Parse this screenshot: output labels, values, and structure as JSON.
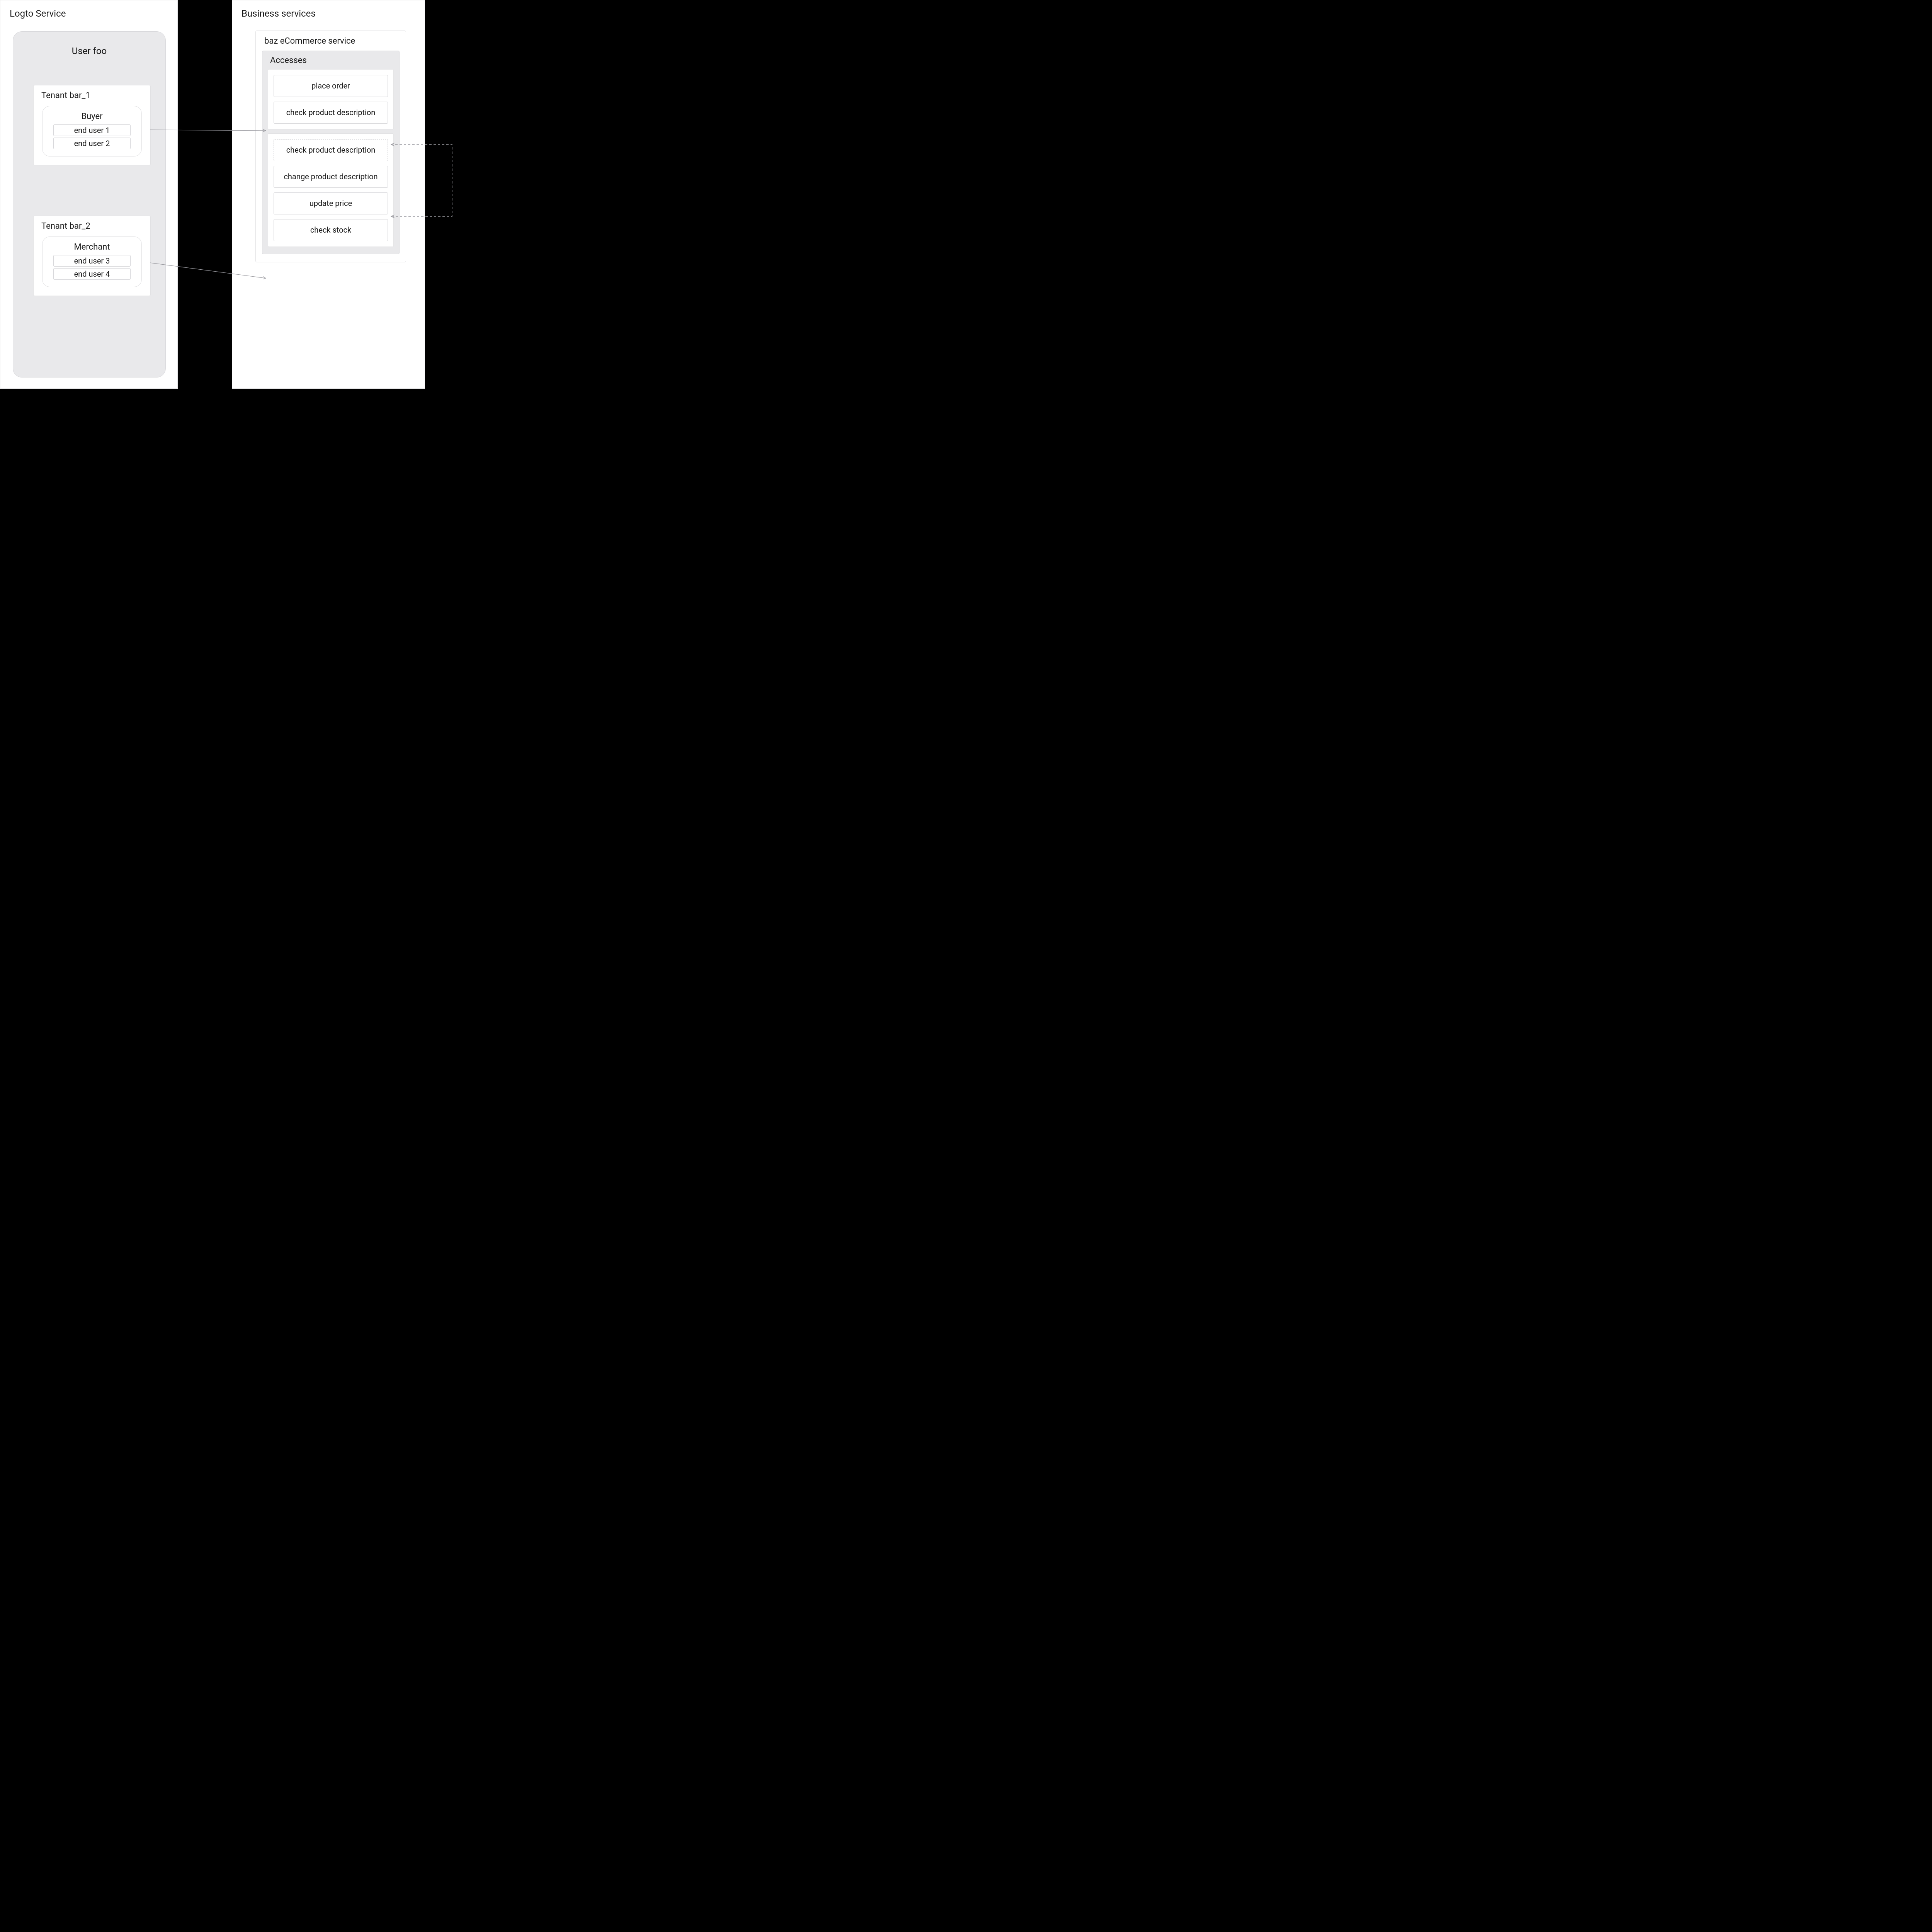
{
  "left": {
    "title": "Logto Service",
    "user": {
      "title": "User foo",
      "tenants": [
        {
          "title": "Tenant bar_1",
          "role": {
            "title": "Buyer",
            "endUsers": [
              "end user 1",
              "end user 2"
            ]
          }
        },
        {
          "title": "Tenant bar_2",
          "role": {
            "title": "Merchant",
            "endUsers": [
              "end user 3",
              "end user 4"
            ]
          }
        }
      ]
    }
  },
  "right": {
    "title": "Business services",
    "service": {
      "title": "baz eCommerce service",
      "accesses": {
        "title": "Accesses",
        "groups": [
          {
            "name": "buyer-accesses",
            "items": [
              {
                "label": "place order",
                "dashed": false
              },
              {
                "label": "check product description",
                "dashed": false
              }
            ]
          },
          {
            "name": "merchant-accesses",
            "items": [
              {
                "label": "check product description",
                "dashed": true
              },
              {
                "label": "change product description",
                "dashed": false
              },
              {
                "label": "update price",
                "dashed": false
              },
              {
                "label": "check stock",
                "dashed": false
              }
            ]
          }
        ]
      }
    }
  },
  "connections": [
    {
      "name": "buyer-to-accesses",
      "from": "buyer-role",
      "to": "buyer-accesses-group",
      "style": "solid"
    },
    {
      "name": "merchant-to-accesses",
      "from": "merchant-role",
      "to": "merchant-accesses-group",
      "style": "solid"
    },
    {
      "name": "shared-access-link",
      "from": "check-product-description-buyer",
      "to": "check-product-description-merchant",
      "style": "dashed",
      "bidirectional": true
    }
  ]
}
